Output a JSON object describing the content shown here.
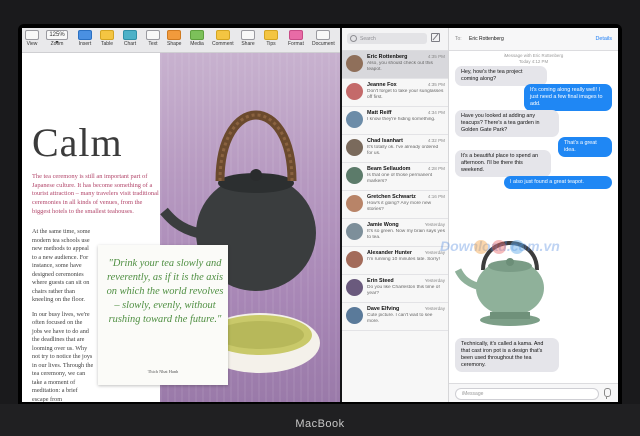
{
  "device": {
    "brand": "MacBook"
  },
  "pages": {
    "toolbar": [
      {
        "label": "View",
        "icon": "sidebar-icon",
        "color": ""
      },
      {
        "label": "Zoom",
        "icon": "zoom-icon",
        "color": "",
        "value": "125% ▾"
      },
      {
        "label": "Insert",
        "icon": "insert-icon",
        "color": "blue"
      },
      {
        "label": "Table",
        "icon": "table-icon",
        "color": "gold"
      },
      {
        "label": "Chart",
        "icon": "chart-icon",
        "color": "teal"
      },
      {
        "label": "Text",
        "icon": "text-icon",
        "color": ""
      },
      {
        "label": "Shape",
        "icon": "shape-icon",
        "color": "orange"
      },
      {
        "label": "Media",
        "icon": "media-icon",
        "color": "green"
      },
      {
        "label": "Comment",
        "icon": "comment-icon",
        "color": "gold"
      },
      {
        "label": "Share",
        "icon": "share-icon",
        "color": ""
      },
      {
        "label": "Tips",
        "icon": "tips-icon",
        "color": "gold"
      },
      {
        "label": "Format",
        "icon": "format-icon",
        "color": "pink"
      },
      {
        "label": "Document",
        "icon": "document-icon",
        "color": ""
      }
    ],
    "document": {
      "title": "Calm",
      "lead": "The tea ceremony is still an important part of Japanese culture. It has become something of a tourist attraction – many travelers visit traditional ceremonies in all kinds of venues, from the biggest hotels to the smallest teahouses.",
      "body": [
        "At the same time, some modern tea schools use new methods to appeal to a new audience. For instance, some have designed ceremonies where guests can sit on chairs rather than kneeling on the floor.",
        "In our busy lives, we're often focused on the jobs we have to do and the deadlines that are looming over us. Why not try to notice the joys in our lives. Through the tea ceremony, we can take a moment of meditation: a brief escape from"
      ],
      "quote": "\"Drink your tea slowly and reverently, as if it is the axis on which the world revolves – slowly, evenly, without rushing toward the future.\"",
      "quote_attribution": "Thich Nhat Hanh"
    }
  },
  "messages": {
    "search_placeholder": "Search",
    "conversations": [
      {
        "name": "Eric Rottenberg",
        "time": "4:35 PM",
        "preview": "Also, you should check out this teapot.",
        "color": "#8f6f5a",
        "selected": true
      },
      {
        "name": "Jeanne Fox",
        "time": "4:35 PM",
        "preview": "Don't forget to take your sunglasses off first.",
        "color": "#c46a6a",
        "selected": false
      },
      {
        "name": "Matt Reiff",
        "time": "4:34 PM",
        "preview": "I know they're hiding something.",
        "color": "#6c8ca8",
        "selected": false
      },
      {
        "name": "Chad Isanhart",
        "time": "4:32 PM",
        "preview": "It's totally ok. I've already ordered for us.",
        "color": "#7a6a5c",
        "selected": false
      },
      {
        "name": "Beam Sellaudom",
        "time": "4:28 PM",
        "preview": "Is that one of those permanent markers?",
        "color": "#5c7b6a",
        "selected": false
      },
      {
        "name": "Gretchen Schwartz",
        "time": "4:16 PM",
        "preview": "How's it going? Any more new stories?",
        "color": "#b88468",
        "selected": false
      },
      {
        "name": "Jamie Wong",
        "time": "Yesterday",
        "preview": "It's so green. Now my brain says yes to tea.",
        "color": "#7d8f9a",
        "selected": false
      },
      {
        "name": "Alexander Hunter",
        "time": "Yesterday",
        "preview": "I'm running 10 minutes late. Sorry!",
        "color": "#a36b5a",
        "selected": false
      },
      {
        "name": "Erin Steed",
        "time": "Yesterday",
        "preview": "Do you like Charleston this time of year?",
        "color": "#6a5a7d",
        "selected": false
      },
      {
        "name": "Dave Elfving",
        "time": "Yesterday",
        "preview": "Cute picture. I can't wait to see more.",
        "color": "#5a7a9a",
        "selected": false
      }
    ],
    "thread": {
      "to_label": "To:",
      "to_name": "Eric Rottenberg",
      "details": "Details",
      "meta_line1": "iMessage with Eric Rottenberg",
      "meta_line2": "Today 4:12 PM",
      "messages": [
        {
          "dir": "in",
          "text": "Hey, how's the tea project coming along?"
        },
        {
          "dir": "out",
          "text": "It's coming along really well! I just need a few final images to add."
        },
        {
          "dir": "in",
          "text": "Have you looked at adding any teacups? There's a tea garden in Golden Gate Park?"
        },
        {
          "dir": "out",
          "text": "That's a great idea."
        },
        {
          "dir": "in",
          "text": "It's a beautiful place to spend an afternoon. I'll be there this weekend."
        },
        {
          "dir": "out",
          "text": "I also just found a great teapot."
        },
        {
          "dir": "in",
          "text": "Technically, it's called a kama. And that cast iron pot is a design that's been used throughout the tea ceremony."
        }
      ],
      "input_placeholder": "iMessage"
    },
    "watermark": "Download.com.vn"
  }
}
